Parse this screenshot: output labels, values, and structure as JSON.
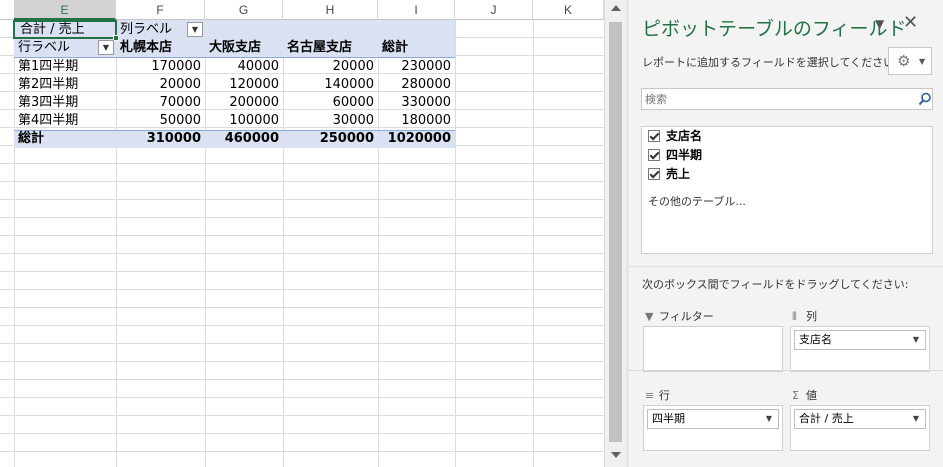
{
  "sheet": {
    "columns": [
      "E",
      "F",
      "G",
      "H",
      "I",
      "J",
      "K"
    ],
    "active_column": "E",
    "pivot": {
      "value_label": "合計 / 売上",
      "col_label": "列ラベル",
      "row_label": "行ラベル",
      "headers": [
        "札幌本店",
        "大阪支店",
        "名古屋支店",
        "総計"
      ],
      "rows": [
        {
          "label": "第1四半期",
          "values": [
            "170000",
            "40000",
            "20000",
            "230000"
          ]
        },
        {
          "label": "第2四半期",
          "values": [
            "20000",
            "120000",
            "140000",
            "280000"
          ]
        },
        {
          "label": "第3四半期",
          "values": [
            "70000",
            "200000",
            "60000",
            "330000"
          ]
        },
        {
          "label": "第4四半期",
          "values": [
            "50000",
            "100000",
            "30000",
            "180000"
          ]
        }
      ],
      "total": {
        "label": "総計",
        "values": [
          "310000",
          "460000",
          "250000",
          "1020000"
        ]
      }
    }
  },
  "pane": {
    "title": "ピボットテーブルのフィールド",
    "subtitle": "レポートに追加するフィールドを選択してください:",
    "search_placeholder": "検索",
    "fields": [
      {
        "name": "支店名",
        "checked": true
      },
      {
        "name": "四半期",
        "checked": true
      },
      {
        "name": "売上",
        "checked": true
      }
    ],
    "other_tables": "その他のテーブル...",
    "drag_hint": "次のボックス間でフィールドをドラッグしてください:",
    "areas": {
      "filter": {
        "label": "フィルター",
        "chip": ""
      },
      "columns": {
        "label": "列",
        "chip": "支店名"
      },
      "rows": {
        "label": "行",
        "chip": "四半期"
      },
      "values": {
        "label": "値",
        "chip": "合計 / 売上"
      }
    }
  },
  "colors": {
    "accent": "#217346",
    "pivot_band": "#d9e1f2"
  }
}
